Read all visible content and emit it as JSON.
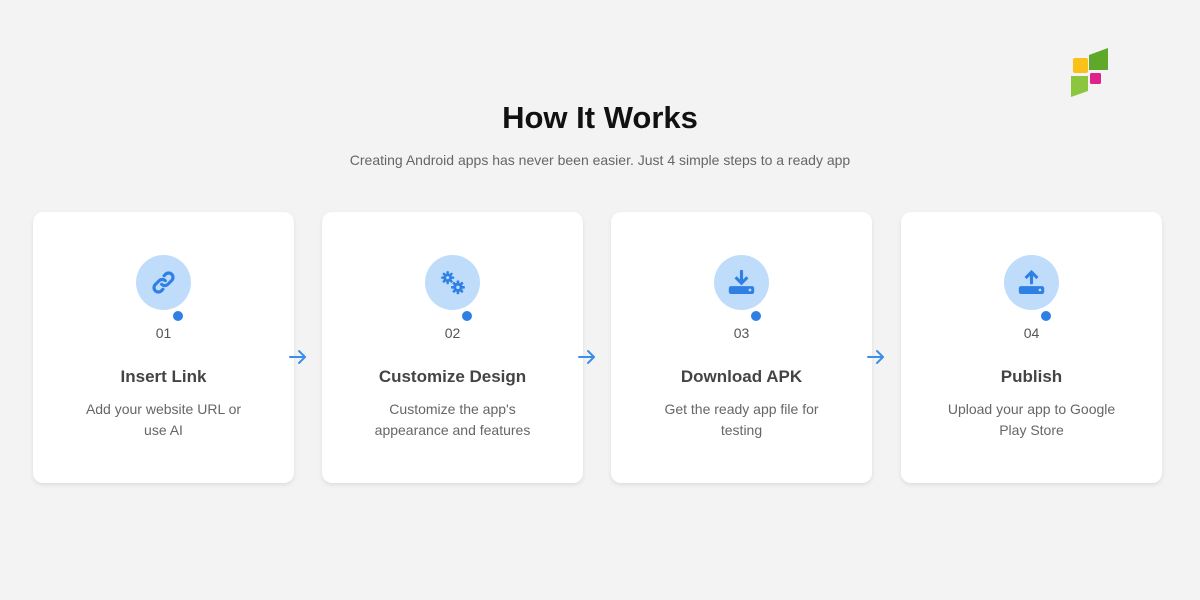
{
  "header": {
    "title": "How It Works",
    "subtitle": "Creating Android apps has never been easier. Just 4 simple steps to a ready app"
  },
  "colors": {
    "accent": "#2f80e4",
    "icon_bg": "#bfdcfb",
    "logo_yellow": "#f9c11a",
    "logo_green": "#5fa82a",
    "logo_lightgreen": "#8cc63f",
    "logo_magenta": "#e0218a"
  },
  "steps": [
    {
      "number": "01",
      "title": "Insert Link",
      "description": "Add your website URL or use AI",
      "icon": "link-icon"
    },
    {
      "number": "02",
      "title": "Customize Design",
      "description": "Customize the app's appearance and features",
      "icon": "gears-icon"
    },
    {
      "number": "03",
      "title": "Download APK",
      "description": "Get the ready app file for testing",
      "icon": "download-icon"
    },
    {
      "number": "04",
      "title": "Publish",
      "description": "Upload your app to Google Play Store",
      "icon": "upload-icon"
    }
  ]
}
